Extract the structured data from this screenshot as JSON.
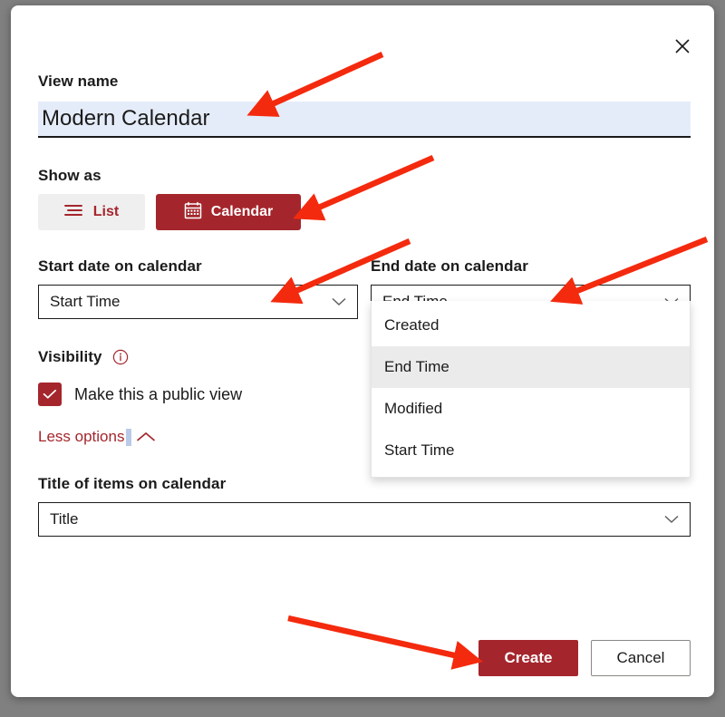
{
  "dialog": {
    "close_icon": "close-icon"
  },
  "view_name": {
    "label": "View name",
    "value": "Modern Calendar",
    "placeholder": "View name"
  },
  "show_as": {
    "label": "Show as",
    "options": [
      {
        "label": "List",
        "icon": "list-icon",
        "selected": false
      },
      {
        "label": "Calendar",
        "icon": "calendar-icon",
        "selected": true
      }
    ]
  },
  "start_date": {
    "label": "Start date on calendar",
    "value": "Start Time"
  },
  "end_date": {
    "label": "End date on calendar",
    "value": "End Time",
    "expanded": true,
    "options": [
      {
        "label": "Created",
        "selected": false
      },
      {
        "label": "End Time",
        "selected": true
      },
      {
        "label": "Modified",
        "selected": false
      },
      {
        "label": "Start Time",
        "selected": false
      }
    ]
  },
  "visibility": {
    "label": "Visibility",
    "info_icon": "info-icon",
    "checkbox_label": "Make this a public view",
    "checked": true
  },
  "less_options": {
    "label": "Less options",
    "icon": "chevron-up-icon"
  },
  "title_items": {
    "label": "Title of items on calendar",
    "value": "Title"
  },
  "footer": {
    "create_label": "Create",
    "cancel_label": "Cancel"
  },
  "colors": {
    "accent": "#a4262c",
    "annotation_arrow": "#f42a0e",
    "input_highlight": "#e5ecf9",
    "dropdown_selected": "#ebebeb",
    "page_background": "#808080"
  }
}
